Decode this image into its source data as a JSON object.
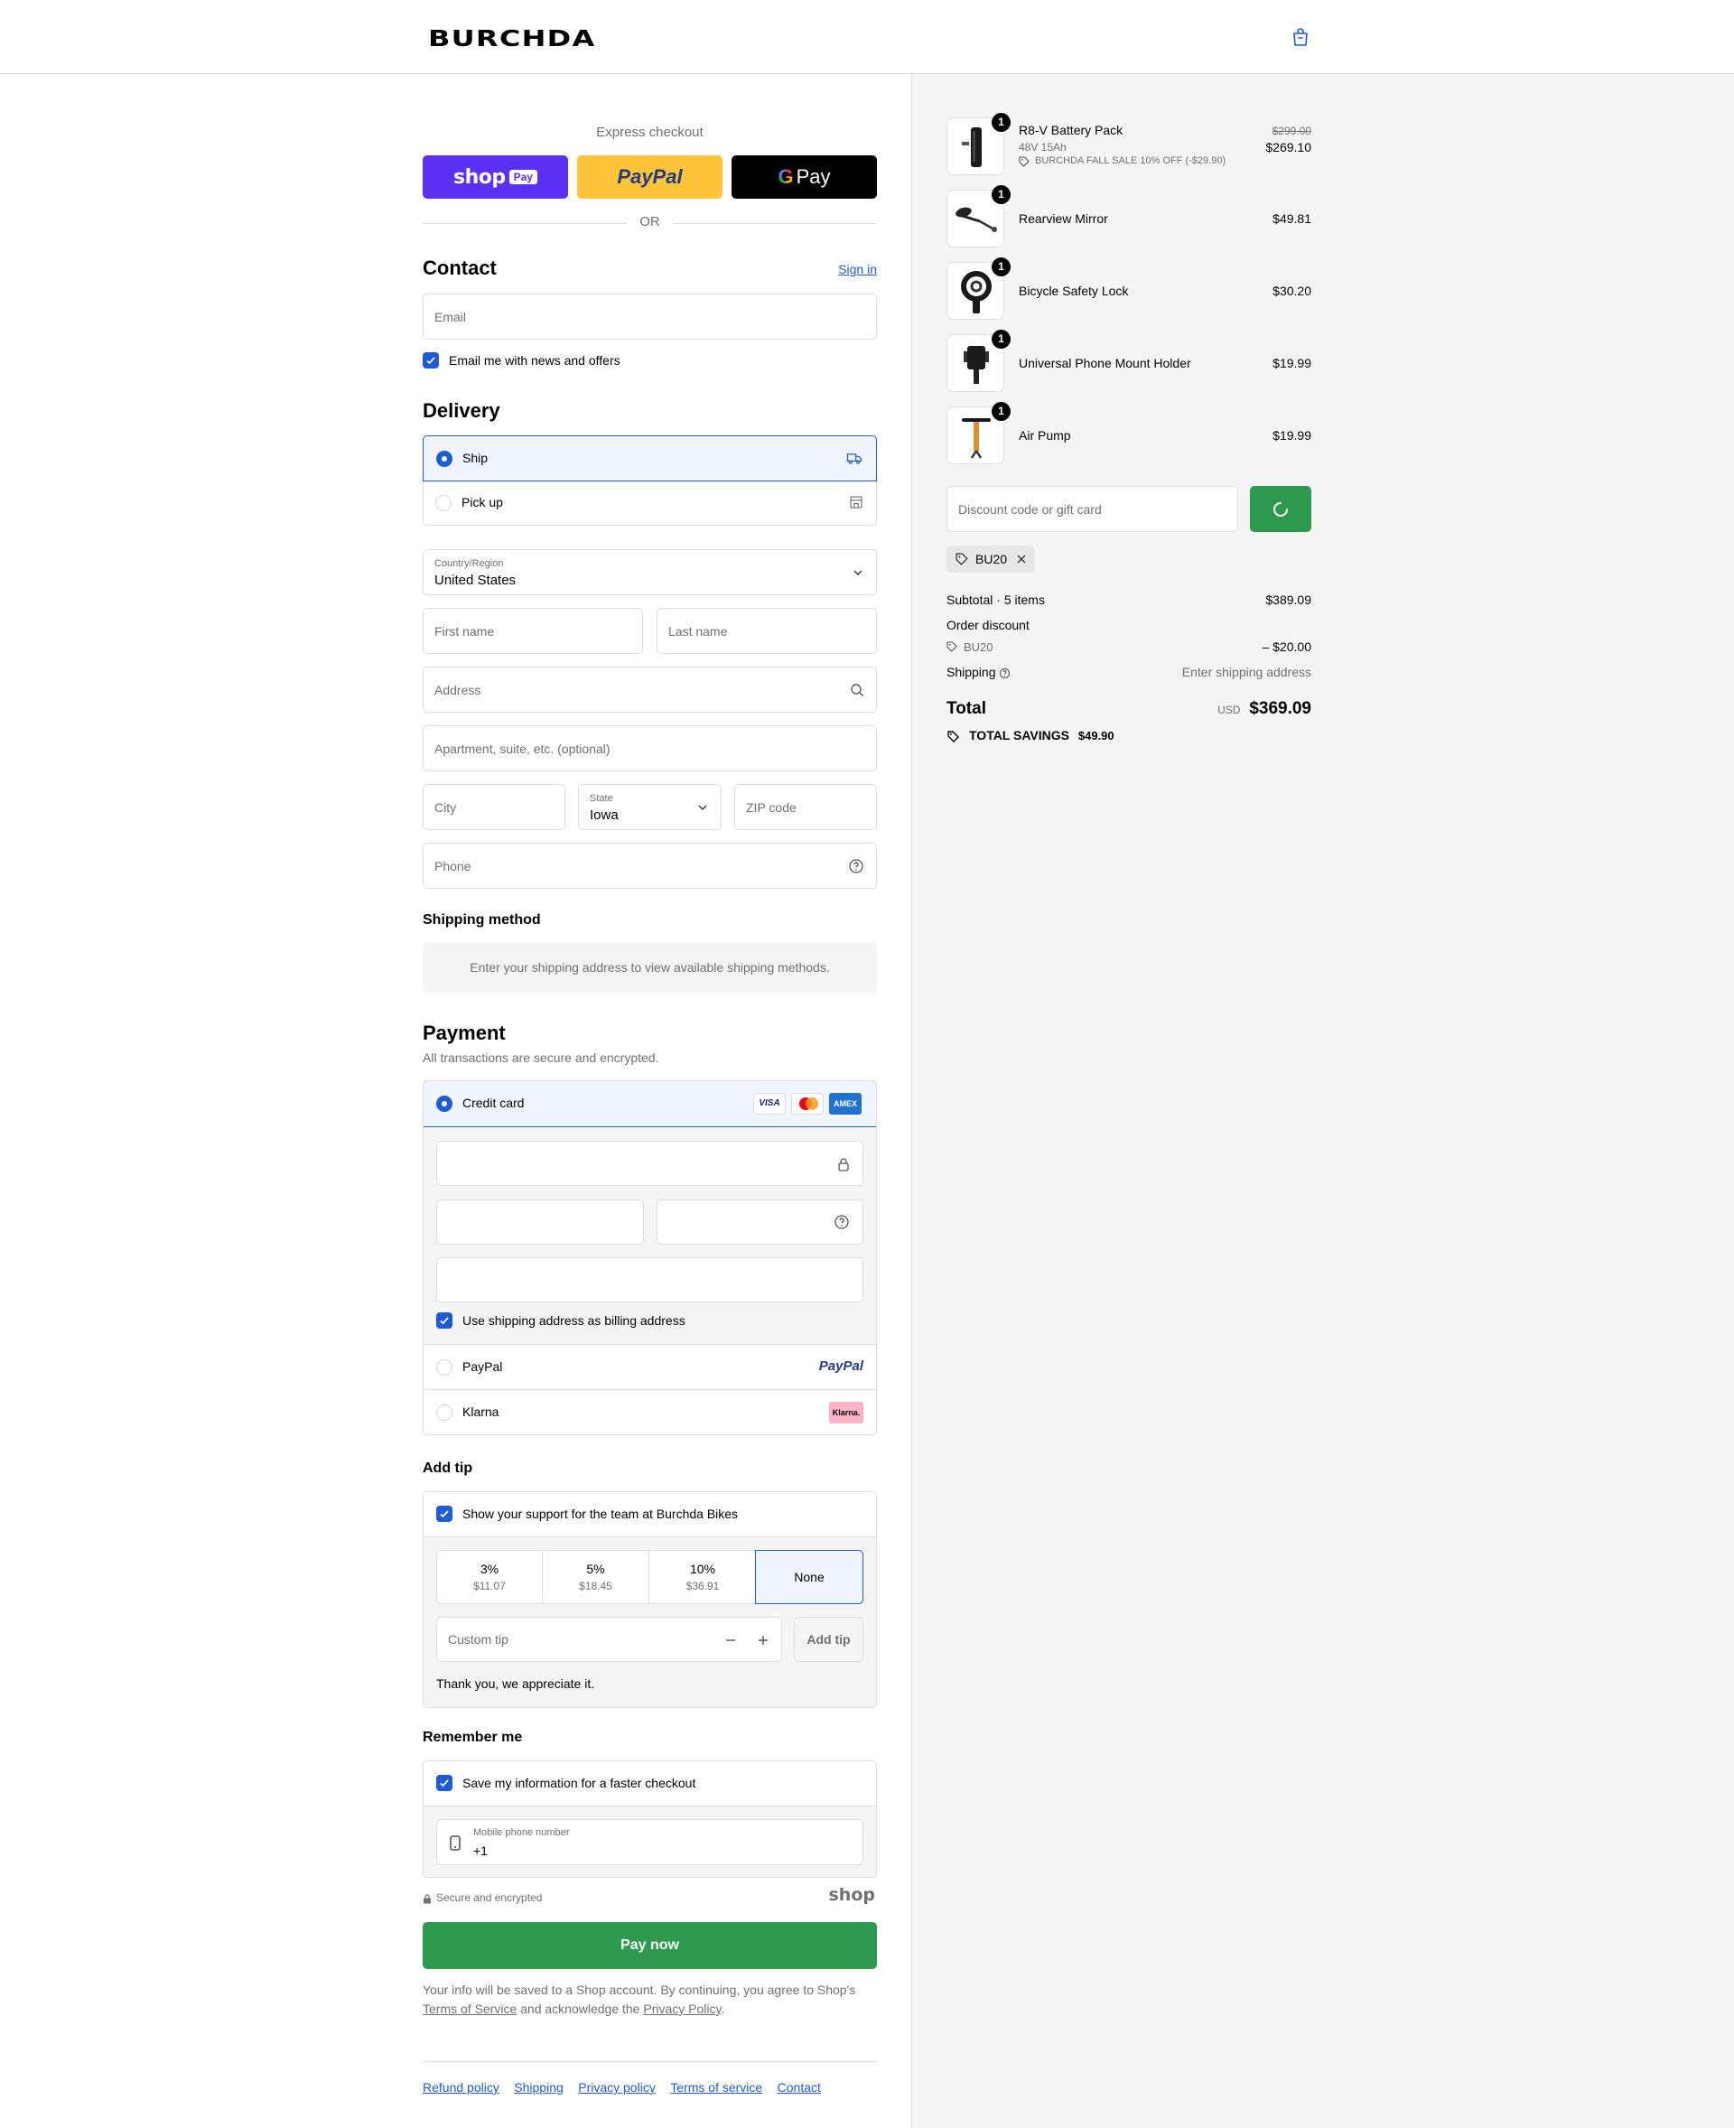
{
  "header": {
    "logo": "BURCHDA",
    "cart_icon": "bag-icon"
  },
  "express": {
    "label": "Express checkout",
    "shop_pay": "shop",
    "shop_pay_badge": "Pay",
    "paypal": "PayPal",
    "gpay": "Pay",
    "or": "OR"
  },
  "contact": {
    "title": "Contact",
    "sign_in": "Sign in",
    "email_placeholder": "Email",
    "news_label": "Email me with news and offers",
    "news_checked": true
  },
  "delivery": {
    "title": "Delivery",
    "options": [
      {
        "label": "Ship",
        "selected": true,
        "icon": "truck-icon"
      },
      {
        "label": "Pick up",
        "selected": false,
        "icon": "store-icon"
      }
    ],
    "country_label": "Country/Region",
    "country_value": "United States",
    "first_name": "First name",
    "last_name": "Last name",
    "address": "Address",
    "apartment": "Apartment, suite, etc. (optional)",
    "city": "City",
    "state_label": "State",
    "state_value": "Iowa",
    "zip": "ZIP code",
    "phone": "Phone"
  },
  "shipping_method": {
    "title": "Shipping method",
    "notice": "Enter your shipping address to view available shipping methods."
  },
  "payment": {
    "title": "Payment",
    "subtitle": "All transactions are secure and encrypted.",
    "credit_card": "Credit card",
    "card_logos": [
      "VISA",
      "mastercard",
      "AMEX"
    ],
    "billing_same": "Use shipping address as billing address",
    "paypal": "PayPal",
    "paypal_logo": "PayPal",
    "klarna": "Klarna",
    "klarna_logo": "Klarna."
  },
  "tip": {
    "title": "Add tip",
    "support_label": "Show your support for the team at Burchda Bikes",
    "options": [
      {
        "percent": "3%",
        "amount": "$11.07"
      },
      {
        "percent": "5%",
        "amount": "$18.45"
      },
      {
        "percent": "10%",
        "amount": "$36.91"
      }
    ],
    "none": "None",
    "custom_placeholder": "Custom tip",
    "add_button": "Add tip",
    "thanks": "Thank you, we appreciate it."
  },
  "remember": {
    "title": "Remember me",
    "save_label": "Save my information for a faster checkout",
    "mobile_label": "Mobile phone number",
    "mobile_value": "+1",
    "secure": "Secure and encrypted",
    "shop_logo": "shop"
  },
  "pay_now": "Pay now",
  "legal": {
    "line1": "Your info will be saved to a Shop account. By continuing, you agree to Shop's",
    "tos": "Terms of Service",
    "mid": "and acknowledge the",
    "privacy": "Privacy Policy",
    "end": "."
  },
  "footer_links": [
    "Refund policy",
    "Shipping",
    "Privacy policy",
    "Terms of service",
    "Contact"
  ],
  "order": {
    "items": [
      {
        "name": "R8-V Battery Pack",
        "variant": "48V 15Ah",
        "discount": "BURCHDA FALL SALE 10% OFF (-$29.90)",
        "original_price": "$299.00",
        "price": "$269.10",
        "qty": "1"
      },
      {
        "name": "Rearview Mirror",
        "price": "$49.81",
        "qty": "1"
      },
      {
        "name": "Bicycle Safety Lock",
        "price": "$30.20",
        "qty": "1"
      },
      {
        "name": "Universal Phone Mount Holder",
        "price": "$19.99",
        "qty": "1"
      },
      {
        "name": "Air Pump",
        "price": "$19.99",
        "qty": "1"
      }
    ],
    "discount_placeholder": "Discount code or gift card",
    "applied_code": "BU20",
    "subtotal_label": "Subtotal · 5 items",
    "subtotal": "$389.09",
    "order_discount_label": "Order discount",
    "discount_code": "BU20",
    "discount_amount": "– $20.00",
    "shipping_label": "Shipping",
    "shipping_value": "Enter shipping address",
    "total_label": "Total",
    "currency": "USD",
    "total": "$369.09",
    "savings_label": "TOTAL SAVINGS",
    "savings": "$49.90"
  },
  "colors": {
    "accent": "#1f5bd4",
    "pay_button": "#2e9a4f",
    "shop_pay": "#5a31f4",
    "paypal": "#ffc439"
  }
}
